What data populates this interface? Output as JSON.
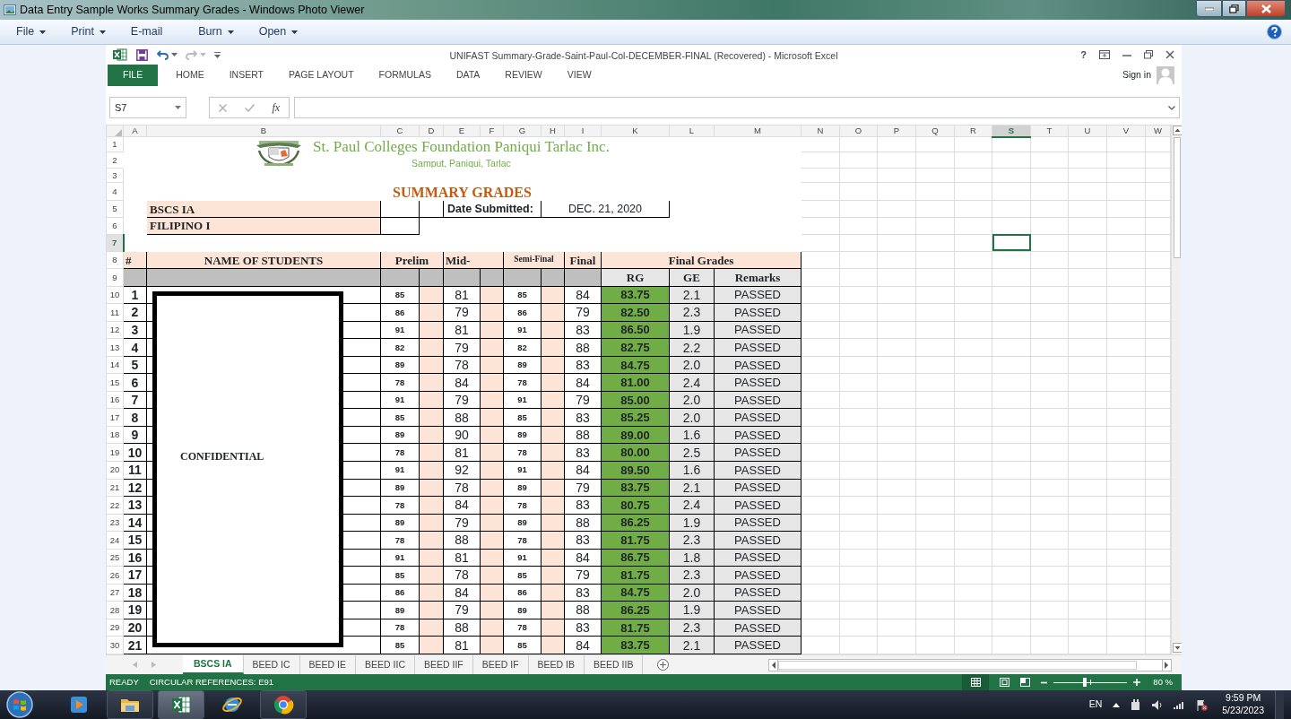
{
  "viewer": {
    "title": "Data Entry Sample Works Summary Grades - Windows Photo Viewer",
    "menu": [
      {
        "label": "File",
        "dropdown": true
      },
      {
        "label": "Print",
        "dropdown": true
      },
      {
        "label": "E-mail",
        "dropdown": false
      },
      {
        "label": "Burn",
        "dropdown": true
      },
      {
        "label": "Open",
        "dropdown": true
      }
    ]
  },
  "excel": {
    "title": "UNIFAST Summary-Grade-Saint-Paul-Col-DECEMBER-FINAL (Recovered) - Microsoft Excel",
    "help_label": "?",
    "sign_in": "Sign in",
    "tabs": [
      {
        "label": "FILE",
        "kind": "file"
      },
      {
        "label": "HOME",
        "kind": "tab"
      },
      {
        "label": "INSERT",
        "kind": "tab"
      },
      {
        "label": "PAGE LAYOUT",
        "kind": "tab"
      },
      {
        "label": "FORMULAS",
        "kind": "tab"
      },
      {
        "label": "DATA",
        "kind": "tab"
      },
      {
        "label": "REVIEW",
        "kind": "tab"
      },
      {
        "label": "VIEW",
        "kind": "tab"
      }
    ],
    "name_box": "S7",
    "function_label": "fx"
  },
  "columns": [
    {
      "label": "A",
      "selected": false
    },
    {
      "label": "B",
      "selected": false
    },
    {
      "label": "C",
      "selected": false
    },
    {
      "label": "D",
      "selected": false
    },
    {
      "label": "E",
      "selected": false
    },
    {
      "label": "F",
      "selected": false
    },
    {
      "label": "G",
      "selected": false
    },
    {
      "label": "H",
      "selected": false
    },
    {
      "label": "I",
      "selected": false
    },
    {
      "label": "K",
      "selected": false
    },
    {
      "label": "L",
      "selected": false
    },
    {
      "label": "M",
      "selected": false
    },
    {
      "label": "N",
      "selected": false
    },
    {
      "label": "O",
      "selected": false
    },
    {
      "label": "P",
      "selected": false
    },
    {
      "label": "Q",
      "selected": false
    },
    {
      "label": "R",
      "selected": false
    },
    {
      "label": "S",
      "selected": true
    },
    {
      "label": "T",
      "selected": false
    },
    {
      "label": "U",
      "selected": false
    },
    {
      "label": "V",
      "selected": false
    },
    {
      "label": "W",
      "selected": false
    }
  ],
  "rows": [
    {
      "label": "1",
      "selected": false
    },
    {
      "label": "2",
      "selected": false
    },
    {
      "label": "3",
      "selected": false
    },
    {
      "label": "4",
      "selected": false
    },
    {
      "label": "5",
      "selected": false
    },
    {
      "label": "6",
      "selected": false
    },
    {
      "label": "7",
      "selected": true
    },
    {
      "label": "8",
      "selected": false
    },
    {
      "label": "9",
      "selected": false
    },
    {
      "label": "10",
      "selected": false
    },
    {
      "label": "11",
      "selected": false
    },
    {
      "label": "12",
      "selected": false
    },
    {
      "label": "13",
      "selected": false
    },
    {
      "label": "14",
      "selected": false
    },
    {
      "label": "15",
      "selected": false
    },
    {
      "label": "16",
      "selected": false
    },
    {
      "label": "17",
      "selected": false
    },
    {
      "label": "18",
      "selected": false
    },
    {
      "label": "19",
      "selected": false
    },
    {
      "label": "20",
      "selected": false
    },
    {
      "label": "21",
      "selected": false
    },
    {
      "label": "22",
      "selected": false
    },
    {
      "label": "23",
      "selected": false
    },
    {
      "label": "24",
      "selected": false
    },
    {
      "label": "25",
      "selected": false
    },
    {
      "label": "26",
      "selected": false
    },
    {
      "label": "27",
      "selected": false
    },
    {
      "label": "28",
      "selected": false
    },
    {
      "label": "29",
      "selected": false
    },
    {
      "label": "30",
      "selected": false
    }
  ],
  "sheet": {
    "school": "St. Paul Colleges Foundation Paniqui Tarlac Inc.",
    "address": "Samput, Paniqui, Tarlac",
    "heading": "SUMMARY GRADES",
    "section": "BSCS IA",
    "subject": "FILIPINO I",
    "date_label": "Date Submitted:",
    "date": "DEC. 21, 2020",
    "headers": {
      "number": "#",
      "name": "NAME OF STUDENTS",
      "prelim": "Prelim",
      "midterm": "Mid-",
      "semi": "Semi-Final",
      "final": "Final",
      "final_grades": "Final Grades",
      "rg": "RG",
      "ge": "GE",
      "remarks": "Remarks"
    },
    "students": [
      {
        "no": "1",
        "prelim": "85",
        "midterm": "81",
        "semi": "85",
        "final": "84",
        "rg": "83.75",
        "ge": "2.1",
        "remarks": "PASSED"
      },
      {
        "no": "2",
        "prelim": "86",
        "midterm": "79",
        "semi": "86",
        "final": "79",
        "rg": "82.50",
        "ge": "2.3",
        "remarks": "PASSED"
      },
      {
        "no": "3",
        "prelim": "91",
        "midterm": "81",
        "semi": "91",
        "final": "83",
        "rg": "86.50",
        "ge": "1.9",
        "remarks": "PASSED"
      },
      {
        "no": "4",
        "prelim": "82",
        "midterm": "79",
        "semi": "82",
        "final": "88",
        "rg": "82.75",
        "ge": "2.2",
        "remarks": "PASSED"
      },
      {
        "no": "5",
        "prelim": "89",
        "midterm": "78",
        "semi": "89",
        "final": "83",
        "rg": "84.75",
        "ge": "2.0",
        "remarks": "PASSED"
      },
      {
        "no": "6",
        "prelim": "78",
        "midterm": "84",
        "semi": "78",
        "final": "84",
        "rg": "81.00",
        "ge": "2.4",
        "remarks": "PASSED"
      },
      {
        "no": "7",
        "prelim": "91",
        "midterm": "79",
        "semi": "91",
        "final": "79",
        "rg": "85.00",
        "ge": "2.0",
        "remarks": "PASSED"
      },
      {
        "no": "8",
        "prelim": "85",
        "midterm": "88",
        "semi": "85",
        "final": "83",
        "rg": "85.25",
        "ge": "2.0",
        "remarks": "PASSED"
      },
      {
        "no": "9",
        "prelim": "89",
        "midterm": "90",
        "semi": "89",
        "final": "88",
        "rg": "89.00",
        "ge": "1.6",
        "remarks": "PASSED"
      },
      {
        "no": "10",
        "prelim": "78",
        "midterm": "81",
        "semi": "78",
        "final": "83",
        "rg": "80.00",
        "ge": "2.5",
        "remarks": "PASSED"
      },
      {
        "no": "11",
        "prelim": "91",
        "midterm": "92",
        "semi": "91",
        "final": "84",
        "rg": "89.50",
        "ge": "1.6",
        "remarks": "PASSED"
      },
      {
        "no": "12",
        "prelim": "89",
        "midterm": "78",
        "semi": "89",
        "final": "79",
        "rg": "83.75",
        "ge": "2.1",
        "remarks": "PASSED"
      },
      {
        "no": "13",
        "prelim": "78",
        "midterm": "84",
        "semi": "78",
        "final": "83",
        "rg": "80.75",
        "ge": "2.4",
        "remarks": "PASSED"
      },
      {
        "no": "14",
        "prelim": "89",
        "midterm": "79",
        "semi": "89",
        "final": "88",
        "rg": "86.25",
        "ge": "1.9",
        "remarks": "PASSED"
      },
      {
        "no": "15",
        "prelim": "78",
        "midterm": "88",
        "semi": "78",
        "final": "83",
        "rg": "81.75",
        "ge": "2.3",
        "remarks": "PASSED"
      },
      {
        "no": "16",
        "prelim": "91",
        "midterm": "81",
        "semi": "91",
        "final": "84",
        "rg": "86.75",
        "ge": "1.8",
        "remarks": "PASSED"
      },
      {
        "no": "17",
        "prelim": "85",
        "midterm": "78",
        "semi": "85",
        "final": "79",
        "rg": "81.75",
        "ge": "2.3",
        "remarks": "PASSED"
      },
      {
        "no": "18",
        "prelim": "86",
        "midterm": "84",
        "semi": "86",
        "final": "83",
        "rg": "84.75",
        "ge": "2.0",
        "remarks": "PASSED"
      },
      {
        "no": "19",
        "prelim": "89",
        "midterm": "79",
        "semi": "89",
        "final": "88",
        "rg": "86.25",
        "ge": "1.9",
        "remarks": "PASSED"
      },
      {
        "no": "20",
        "prelim": "78",
        "midterm": "88",
        "semi": "78",
        "final": "83",
        "rg": "81.75",
        "ge": "2.3",
        "remarks": "PASSED"
      },
      {
        "no": "21",
        "prelim": "85",
        "midterm": "81",
        "semi": "85",
        "final": "84",
        "rg": "83.75",
        "ge": "2.1",
        "remarks": "PASSED"
      }
    ],
    "confidential": "CONFIDENTIAL"
  },
  "sheet_tabs": [
    {
      "label": "BSCS IA",
      "selected": true
    },
    {
      "label": "BEED IC",
      "selected": false
    },
    {
      "label": "BEED IE",
      "selected": false
    },
    {
      "label": "BEED IIC",
      "selected": false
    },
    {
      "label": "BEED IIF",
      "selected": false
    },
    {
      "label": "BEED IF",
      "selected": false
    },
    {
      "label": "BEED IB",
      "selected": false
    },
    {
      "label": "BEED IIB",
      "selected": false
    }
  ],
  "status": {
    "mode": "READY",
    "message": "CIRCULAR REFERENCES: E91",
    "zoom": "80 %",
    "zoom_slider": {
      "level": 0.42
    }
  },
  "taskbar": {
    "apps": [
      {
        "kind": "media",
        "open": false,
        "selected": false
      },
      {
        "kind": "folder",
        "open": true,
        "selected": false
      },
      {
        "kind": "excel",
        "open": true,
        "selected": true
      },
      {
        "kind": "ie",
        "open": false,
        "selected": false
      },
      {
        "kind": "chrome",
        "open": true,
        "selected": false
      }
    ],
    "language": "EN",
    "time": "9:59 PM",
    "date": "5/23/2023"
  }
}
